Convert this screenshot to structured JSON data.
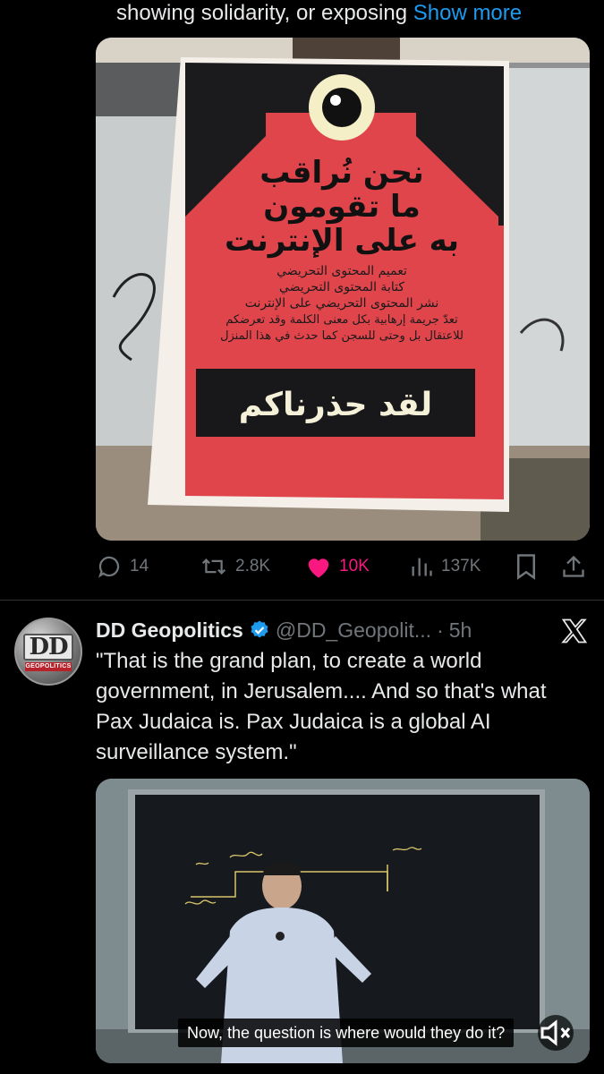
{
  "top_tweet": {
    "text_tail": "showing solidarity, or exposing",
    "show_more": "Show more",
    "poster": {
      "headline_lines": [
        "نحن نُراقب",
        "ما تقومون",
        "به على الإنترنت"
      ],
      "body_lines": [
        "تعميم المحتوى التحريضي",
        "كتابة المحتوى التحريضي",
        "نشر المحتوى التحريضي على الإنترنت",
        "تعدّ جريمة إرهابية بكل معنى الكلمة وقد تعرضكم",
        "للاعتقال بل وحتى للسجن كما حدث في هذا المنزل"
      ],
      "banner": "لقد حذرناكم"
    },
    "actions": {
      "replies": "14",
      "reposts": "2.8K",
      "likes": "10K",
      "views": "137K"
    }
  },
  "tweet": {
    "author_name": "DD Geopolitics",
    "handle": "@DD_Geopolit...",
    "separator": "·",
    "time": "5h",
    "avatar": {
      "big_letters": "DD",
      "small_text": "GEOPOLITICS"
    },
    "text": "\"That is the grand plan, to create a world government, in Jerusalem.... And so that's what Pax Judaica is. Pax Judaica is a global AI surveillance system.\"",
    "video": {
      "caption": "Now, the question is where would they do it?"
    }
  },
  "colors": {
    "background": "#000000",
    "text": "#e7e9ea",
    "muted": "#71767b",
    "link": "#1d9bf0",
    "like": "#f91880",
    "verified": "#1d9bf0",
    "poster_red": "#e0454c"
  },
  "icons": [
    "reply-icon",
    "repost-icon",
    "heart-icon",
    "views-icon",
    "bookmark-icon",
    "share-icon",
    "verified-badge-icon",
    "x-logo-icon",
    "mute-icon"
  ]
}
